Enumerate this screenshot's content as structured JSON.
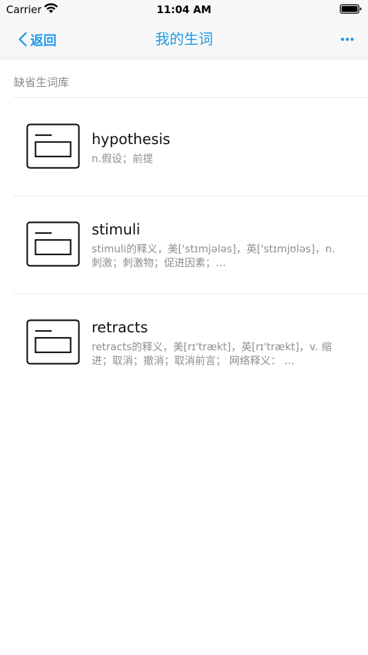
{
  "status": {
    "carrier": "Carrier",
    "time": "11:04 AM"
  },
  "nav": {
    "back_label": "返回",
    "title": "我的生词"
  },
  "section": {
    "header": "缺省生词库"
  },
  "words": [
    {
      "word": "hypothesis",
      "definition": "n.假设；前提"
    },
    {
      "word": "stimuli",
      "definition": "stimuli的释义，美['stɪmjələs]，英['stɪmjʊləs]，n. 刺激；刺激物；促进因素；…"
    },
    {
      "word": "retracts",
      "definition": "retracts的释义，美[rɪ'trækt]，英[rɪ'trækt]，v. 缩进；取消；撤消；取消前言； 网络释义： …"
    }
  ],
  "colors": {
    "accent": "#1f9bea",
    "bar_bg": "#f7f7f7",
    "secondary_text": "#8e8e8e"
  },
  "icons": {
    "row_icon": "card-icon",
    "back": "chevron-left-icon",
    "more": "more-dots-icon"
  }
}
